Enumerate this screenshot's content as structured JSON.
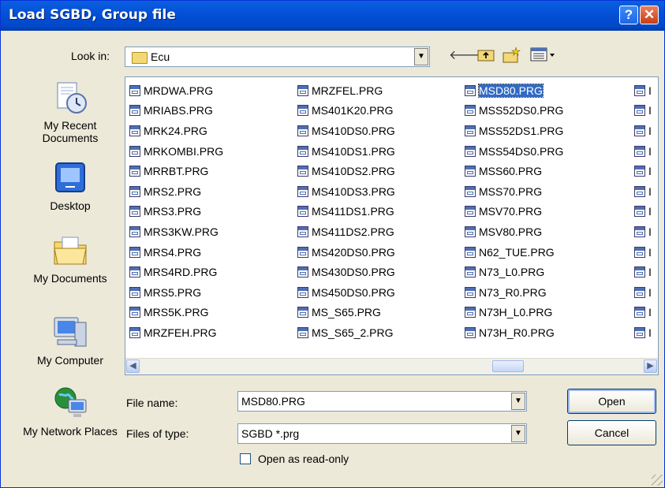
{
  "window": {
    "title": "Load SGBD, Group file",
    "help_label": "?",
    "close_label": "✕"
  },
  "lookin": {
    "label": "Look in:",
    "value": "Ecu"
  },
  "toolbar": {
    "back_icon": "back-arrow-icon",
    "up_icon": "up-folder-icon",
    "new_folder_icon": "new-folder-icon",
    "views_icon": "views-menu-icon"
  },
  "places": [
    {
      "label": "My Recent Documents",
      "icon": "recent-documents-icon"
    },
    {
      "label": "Desktop",
      "icon": "desktop-icon"
    },
    {
      "label": "My Documents",
      "icon": "my-documents-icon"
    },
    {
      "label": "My Computer",
      "icon": "my-computer-icon"
    },
    {
      "label": "My Network Places",
      "icon": "network-places-icon"
    }
  ],
  "files": {
    "columns": [
      [
        "MRDWA.PRG",
        "MRIABS.PRG",
        "MRK24.PRG",
        "MRKOMBI.PRG",
        "MRRBT.PRG",
        "MRS2.PRG",
        "MRS3.PRG",
        "MRS3KW.PRG",
        "MRS4.PRG",
        "MRS4RD.PRG",
        "MRS5.PRG",
        "MRS5K.PRG",
        "MRZFEH.PRG"
      ],
      [
        "MRZFEL.PRG",
        "MS401K20.PRG",
        "MS410DS0.PRG",
        "MS410DS1.PRG",
        "MS410DS2.PRG",
        "MS410DS3.PRG",
        "MS411DS1.PRG",
        "MS411DS2.PRG",
        "MS420DS0.PRG",
        "MS430DS0.PRG",
        "MS450DS0.PRG",
        "MS_S65.PRG",
        "MS_S65_2.PRG"
      ],
      [
        "MSD80.PRG",
        "MSS52DS0.PRG",
        "MSS52DS1.PRG",
        "MSS54DS0.PRG",
        "MSS60.PRG",
        "MSS70.PRG",
        "MSV70.PRG",
        "MSV80.PRG",
        "N62_TUE.PRG",
        "N73_L0.PRG",
        "N73_R0.PRG",
        "N73H_L0.PRG",
        "N73H_R0.PRG"
      ]
    ],
    "partial_column_prefix": "I",
    "selected": "MSD80.PRG"
  },
  "form": {
    "filename_label": "File name:",
    "filename_value": "MSD80.PRG",
    "filetype_label": "Files of type:",
    "filetype_value": "SGBD *.prg",
    "readonly_label": "Open as read-only"
  },
  "buttons": {
    "open": "Open",
    "cancel": "Cancel"
  },
  "colors": {
    "title_bar": "#0a5fe0",
    "selection": "#316ac5",
    "dialog_bg": "#ece9d8"
  }
}
